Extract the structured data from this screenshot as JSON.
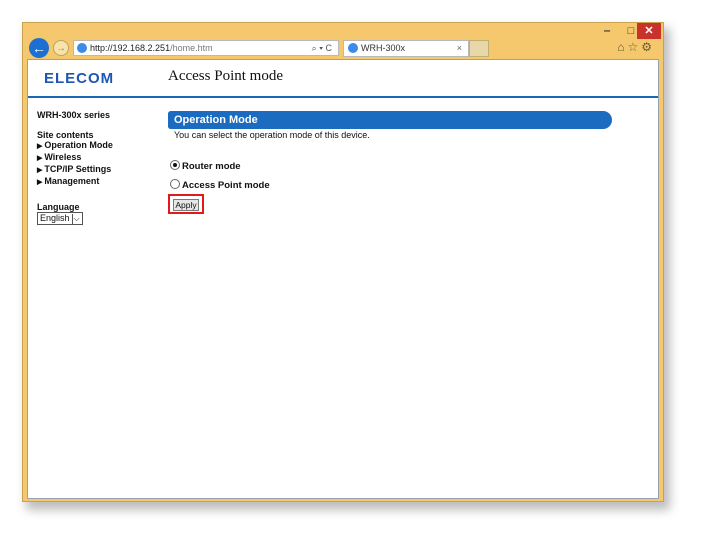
{
  "browser": {
    "address_host": "http://192.168.2.251",
    "address_path": "/home.htm",
    "address_tools": "⌕ ▾ C",
    "tab_title": "WRH-300x",
    "tab_close": "×",
    "window_min": "‒",
    "window_max": "□",
    "window_close": "✕",
    "right_tools": "⌂☆⚙"
  },
  "header": {
    "logo": "ELECOM",
    "page_title": "Access Point mode"
  },
  "sidebar": {
    "model": "WRH-300x series",
    "site_contents_label": "Site contents",
    "items": [
      {
        "label": "Operation Mode"
      },
      {
        "label": "Wireless"
      },
      {
        "label": "TCP/IP Settings"
      },
      {
        "label": "Management"
      }
    ],
    "language_label": "Language",
    "language_value": "English"
  },
  "main": {
    "section_title": "Operation Mode",
    "description": "You can select the operation mode of this device.",
    "options": [
      {
        "label": "Router mode",
        "selected": true
      },
      {
        "label": "Access Point mode",
        "selected": false
      }
    ],
    "apply_label": "Apply"
  },
  "colors": {
    "accent": "#1b6cc0",
    "window_frame": "#f5c86e",
    "highlight": "#e0191c"
  }
}
